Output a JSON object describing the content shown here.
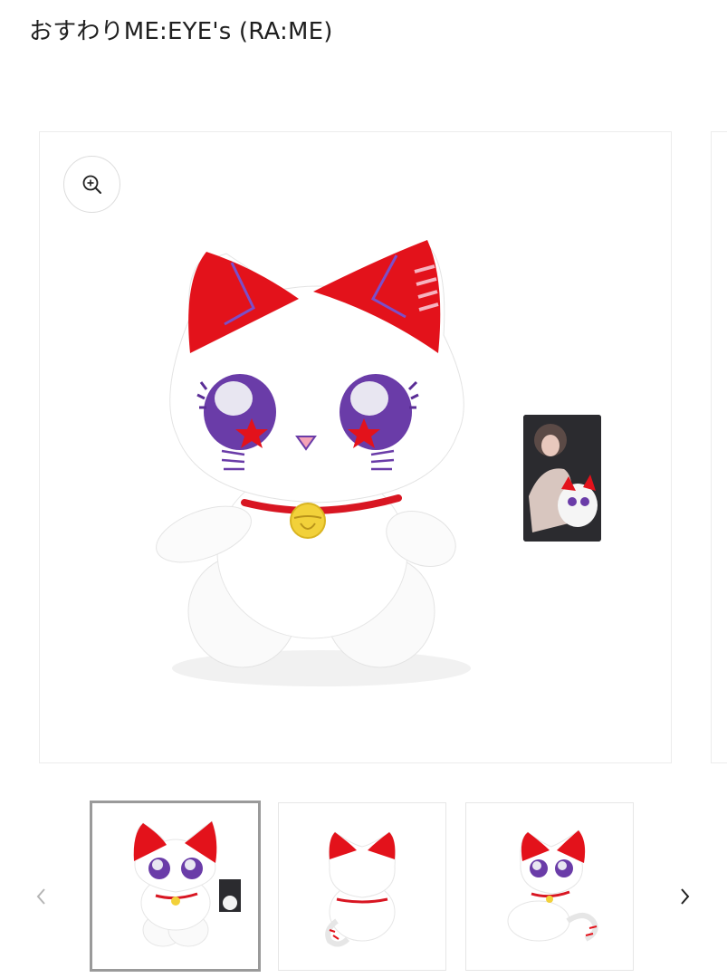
{
  "product": {
    "title": "おすわりME:EYE's (RA:ME)"
  },
  "gallery": {
    "zoom_icon": "zoom-in-icon",
    "main_image": "plush-cat-front",
    "thumbnails": [
      {
        "image": "plush-cat-front",
        "selected": true
      },
      {
        "image": "plush-cat-back",
        "selected": false
      },
      {
        "image": "plush-cat-side",
        "selected": false
      }
    ],
    "prev_icon": "chevron-left-icon",
    "next_icon": "chevron-right-icon"
  },
  "colors": {
    "ear_red": "#e3121b",
    "eye_purple": "#6a3ca8",
    "collar_red": "#d81622",
    "bell_yellow": "#f2d13a"
  }
}
